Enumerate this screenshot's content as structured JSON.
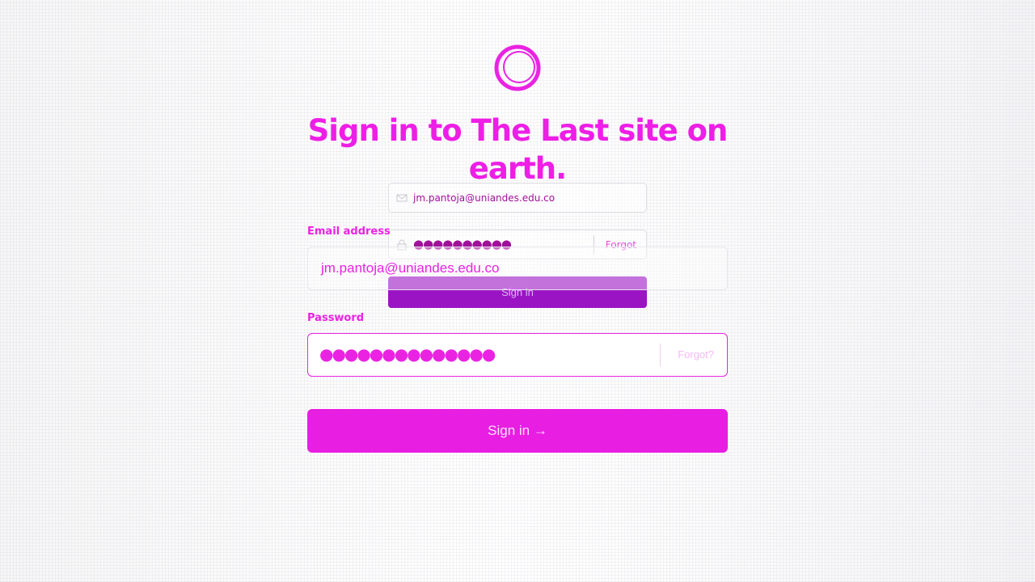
{
  "colors": {
    "accent": "#ea23e2",
    "ghost_button": "#9b14c4"
  },
  "header": {
    "logo_icon": "circle-logo-icon",
    "title": "Sign in to The Last site on earth."
  },
  "ghost_form": {
    "email_icon": "mail-icon",
    "email_value": "jm.pantoja@uniandes.edu.co",
    "password_icon": "lock-icon",
    "password_mask": "●●●●●●●●●●",
    "forgot_label": "Forgot",
    "button_label": "Sign in"
  },
  "form": {
    "email_label": "Email address",
    "email_value": "jm.pantoja@uniandes.edu.co",
    "password_label": "Password",
    "password_mask": "●●●●●●●●●●●●●●",
    "forgot_label": "Forgot?",
    "submit_label": "Sign in →"
  }
}
